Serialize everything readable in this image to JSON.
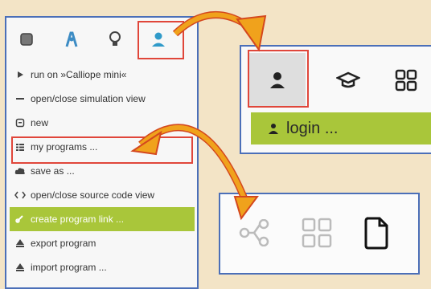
{
  "left_panel": {
    "toolbar": [
      {
        "name": "program-tab-icon"
      },
      {
        "name": "robot-tab-icon"
      },
      {
        "name": "lightbulb-tab-icon"
      },
      {
        "name": "user-tab-icon"
      }
    ],
    "menu": [
      {
        "label": "run on »Calliope mini«",
        "icon": "play-icon"
      },
      {
        "label": "open/close simulation view",
        "icon": "minus-icon"
      },
      {
        "label": "new",
        "icon": "new-file-icon"
      },
      {
        "label": "my programs ...",
        "icon": "list-icon"
      },
      {
        "label": "save as ...",
        "icon": "cloud-save-icon"
      },
      {
        "label": "open/close source code view",
        "icon": "code-icon"
      },
      {
        "label": "create program link ...",
        "icon": "link-icon"
      },
      {
        "label": "export program",
        "icon": "export-icon"
      },
      {
        "label": "import program ...",
        "icon": "import-icon"
      }
    ]
  },
  "right_top": {
    "icons": [
      "user-icon",
      "graduation-cap-icon",
      "gallery-grid-icon"
    ],
    "login_label": "login ..."
  },
  "right_bottom": {
    "icons": [
      "share-nodes-icon",
      "gallery-grid-icon",
      "document-icon"
    ]
  },
  "colors": {
    "background": "#f3e4c6",
    "panel_border": "#4b6fb8",
    "accent_green": "#a9c63a",
    "highlight_red": "#e0463a",
    "arrow_orange": "#f0a21c"
  }
}
